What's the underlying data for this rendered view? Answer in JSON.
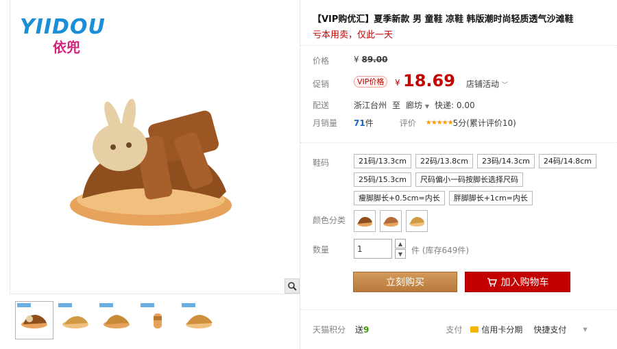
{
  "brand": {
    "en": "YIIDOU",
    "cn": "依兜"
  },
  "product": {
    "title": "【VIP购优汇】夏季新款 男 童鞋 凉鞋 韩版潮时尚轻质透气沙滩鞋",
    "subtitle": "亏本用卖，仅此一天"
  },
  "price": {
    "label": "价格",
    "currency": "¥",
    "original": "89.00"
  },
  "promo": {
    "label": "促销",
    "tag": "VIP价格",
    "currency": "¥",
    "value": "18.69",
    "store_activity": "店铺活动"
  },
  "shipping": {
    "label": "配送",
    "from": "浙江台州",
    "to_word": "至",
    "destination": "廊坊",
    "express": "快递: 0.00"
  },
  "sales": {
    "label": "月销量",
    "count": "71",
    "unit": "件",
    "review_label": "评价",
    "stars": "★★★★★",
    "score": "5分",
    "review_text": "(累计评价10)"
  },
  "size": {
    "label": "鞋码",
    "options": [
      "21码/13.3cm",
      "22码/13.8cm",
      "23码/14.3cm",
      "24码/14.8cm",
      "25码/15.3cm",
      "尺码偏小一码按脚长选择尺码",
      "瘦脚脚长+0.5cm=内长",
      "胖脚脚长+1cm=内长"
    ]
  },
  "color": {
    "label": "颜色分类"
  },
  "quantity": {
    "label": "数量",
    "value": "1",
    "stock": "件 (库存649件)"
  },
  "actions": {
    "buy": "立刻购买",
    "cart": "加入购物车"
  },
  "bottom": {
    "points_label": "天猫积分",
    "points_value": "送",
    "points_num": "9",
    "pay_label": "支付",
    "pay_credit": "信用卡分期",
    "pay_quick": "快捷支付"
  },
  "colors": {
    "accent_red": "#c40000",
    "buy_brown": "#c98d4e",
    "star": "#ff9900",
    "link_blue": "#1964b8"
  }
}
